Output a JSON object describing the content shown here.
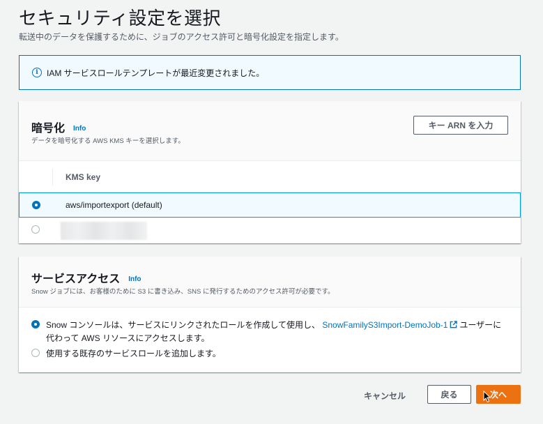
{
  "page": {
    "title": "セキュリティ設定を選択",
    "description": "転送中のデータを保護するために、ジョブのアクセス許可と暗号化設定を指定します。"
  },
  "alert": {
    "icon": "info-circle-icon",
    "text": "IAM サービスロールテンプレートが最近変更されました。"
  },
  "encryption": {
    "title": "暗号化",
    "info": "Info",
    "description": "データを暗号化する AWS KMS キーを選択します。",
    "arn_button": "キー ARN を入力",
    "column_header": "KMS key",
    "rows": [
      {
        "label": "aws/importexport (default)",
        "selected": true
      },
      {
        "label": "",
        "selected": false,
        "redacted": true
      }
    ]
  },
  "service_access": {
    "title": "サービスアクセス",
    "info": "Info",
    "description": "Snow ジョブには、お客様のために S3 に書き込み、SNS に発行するためのアクセス許可が必要です。",
    "option1_prefix": "Snow コンソールは、サービスにリンクされたロールを作成して使用し、",
    "option1_link": "SnowFamilyS3Import-DemoJob-1",
    "option1_suffix": "ユーザーに代わって AWS リソースにアクセスします。",
    "option2": "使用する既存のサービスロールを追加します。",
    "selected_option": 1
  },
  "footer": {
    "cancel": "キャンセル",
    "back": "戻る",
    "next": "次へ"
  },
  "colors": {
    "primary": "#ec7211",
    "link": "#0073bb",
    "selected_row_bg": "#f1faff",
    "selected_row_border": "#00a1c9"
  }
}
